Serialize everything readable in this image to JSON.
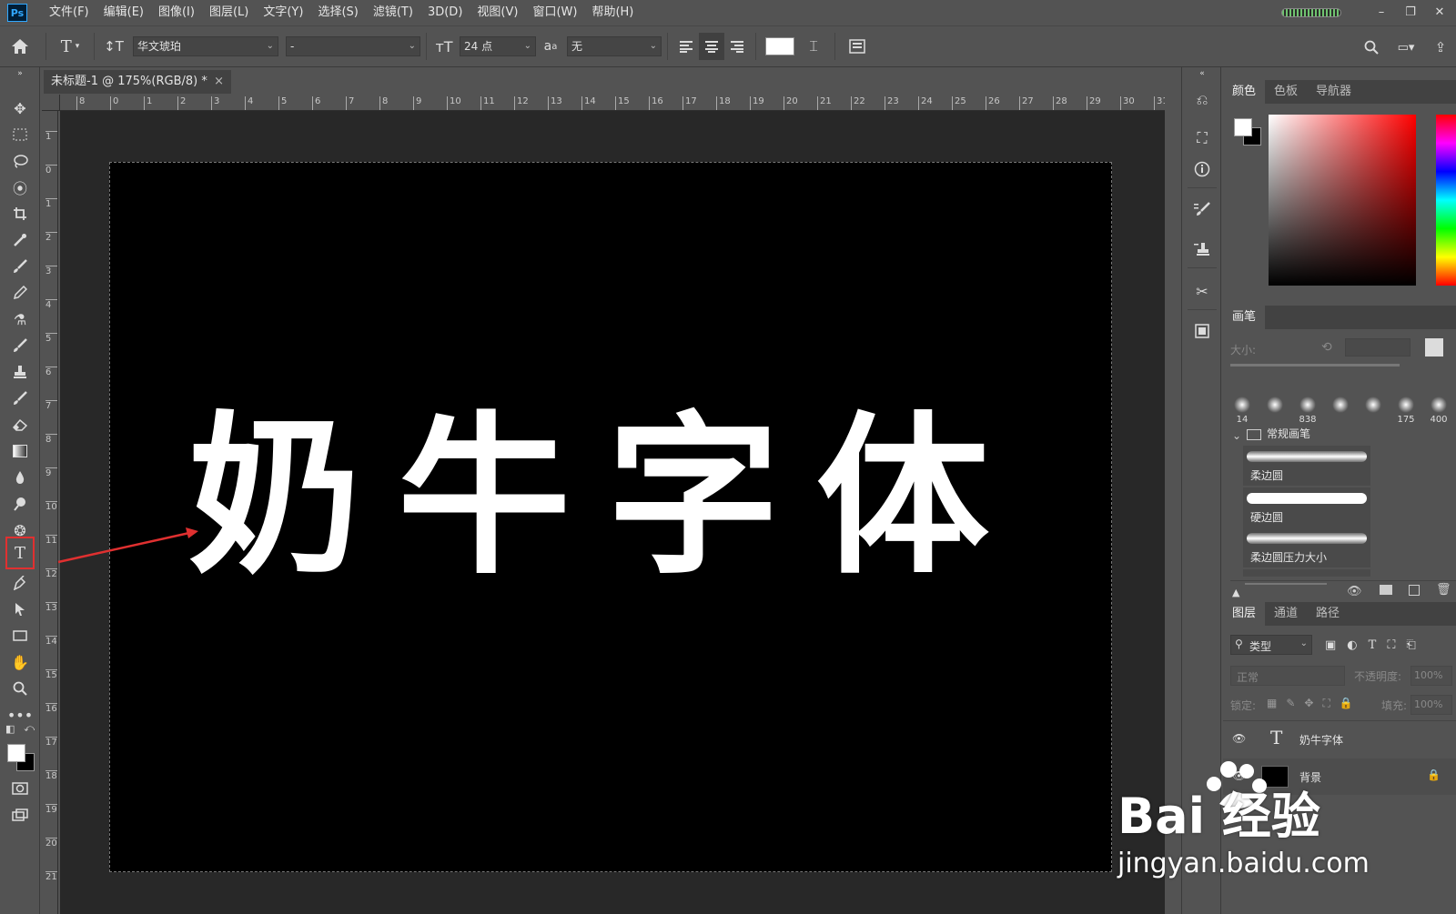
{
  "app": {
    "logo": "Ps"
  },
  "menu": [
    "文件(F)",
    "编辑(E)",
    "图像(I)",
    "图层(L)",
    "文字(Y)",
    "选择(S)",
    "滤镜(T)",
    "3D(D)",
    "视图(V)",
    "窗口(W)",
    "帮助(H)"
  ],
  "options": {
    "font_family": "华文琥珀",
    "font_style": "-",
    "font_size": "24 点",
    "antialias_label": "a",
    "antialias": "无",
    "text_color": "#ffffff"
  },
  "document": {
    "tab_title": "未标题-1 @ 175%(RGB/8) *",
    "close": "×",
    "canvas_text": "奶牛字体",
    "background": "#000000"
  },
  "ruler": {
    "top": [
      "8",
      "0",
      "1",
      "2",
      "3",
      "4",
      "5",
      "6",
      "7",
      "8",
      "9",
      "10",
      "11",
      "12",
      "13",
      "14",
      "15",
      "16",
      "17",
      "18",
      "19",
      "20",
      "21",
      "22",
      "23",
      "24",
      "25",
      "26",
      "27",
      "28",
      "29",
      "30",
      "31"
    ],
    "left": [
      "1",
      "0",
      "1",
      "2",
      "3",
      "4",
      "5",
      "6",
      "7",
      "8",
      "9",
      "10",
      "11",
      "12",
      "13",
      "14",
      "15",
      "16",
      "17",
      "18",
      "19",
      "20",
      "21"
    ]
  },
  "color_panel": {
    "tabs": [
      "颜色",
      "色板",
      "导航器"
    ]
  },
  "brush_panel": {
    "tab": "画笔",
    "size_label": "大小:",
    "tips": [
      "14",
      "",
      "838",
      "",
      "",
      "175",
      "400"
    ],
    "group": "常规画笔",
    "brushes": [
      "柔边圆",
      "硬边圆",
      "柔边圆压力大小"
    ]
  },
  "layers_panel": {
    "tabs": [
      "图层",
      "通道",
      "路径"
    ],
    "filter": "类型",
    "blend": "正常",
    "opacity_label": "不透明度:",
    "opacity": "100%",
    "lock_label": "锁定:",
    "fill_label": "填充:",
    "fill": "100%",
    "layers": [
      {
        "name": "奶牛字体",
        "kind": "T"
      },
      {
        "name": "背景",
        "kind": "image"
      }
    ]
  },
  "watermark": {
    "brand": "Bai 经验",
    "url": "jingyan.baidu.com"
  },
  "colors": {
    "accent_red": "#e03030",
    "highlight": "#31a8ff"
  }
}
